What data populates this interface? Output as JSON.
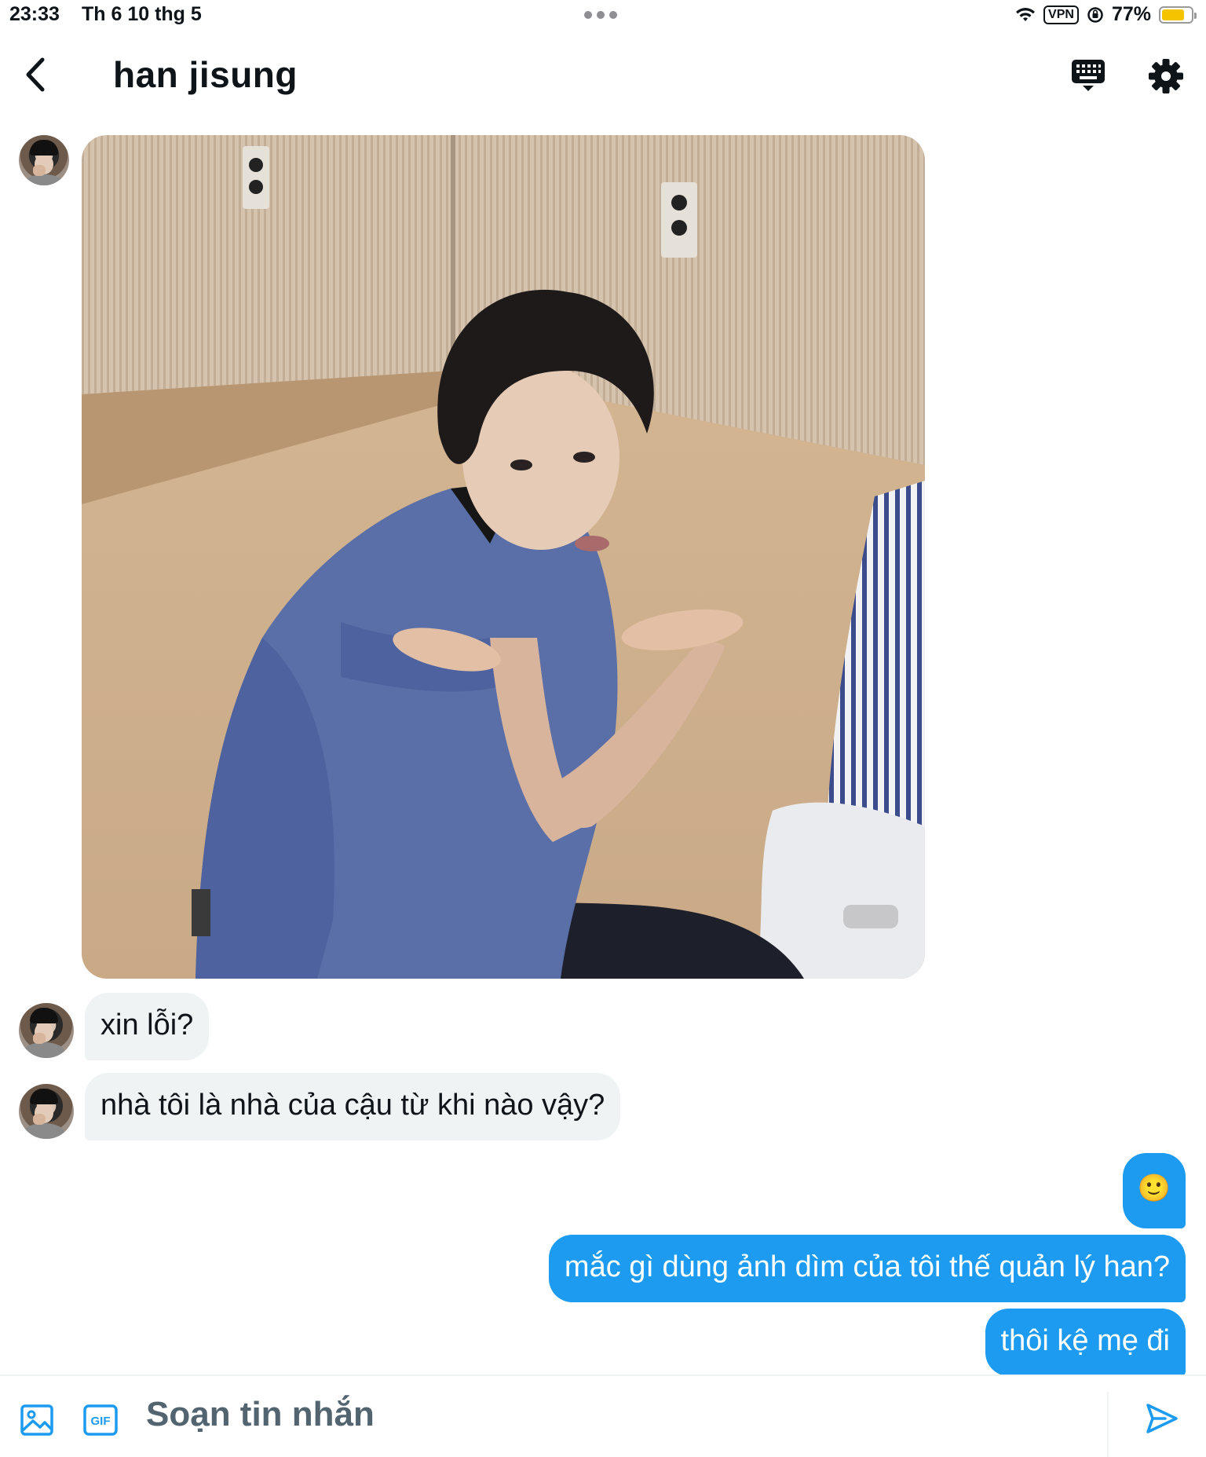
{
  "status_bar": {
    "time": "23:33",
    "date": "Th 6 10 thg 5",
    "vpn": "VPN",
    "battery": "77%",
    "battery_level": 0.77
  },
  "header": {
    "title": "han jisung"
  },
  "messages": {
    "received_1": "xin lỗi?",
    "received_2": "nhà tôi là nhà của cậu từ khi nào vậy?",
    "sent_emoji": "🙂",
    "sent_1": "mắc gì dùng ảnh dìm của tôi thế quản lý han?",
    "sent_2": "thôi kệ mẹ đi"
  },
  "composer": {
    "placeholder": "Soạn tin nhắn",
    "gif_label": "GIF"
  },
  "colors": {
    "accent": "#1d9bf0",
    "incoming_bubble": "#eff3f4",
    "battery_fill": "#f5c400"
  }
}
